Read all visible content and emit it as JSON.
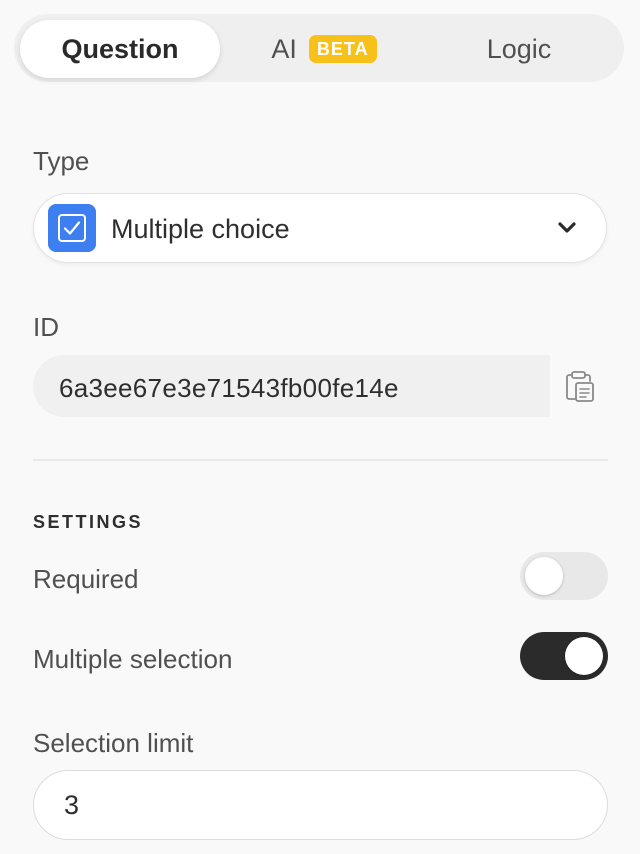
{
  "tabs": {
    "question": "Question",
    "ai": "AI",
    "ai_badge": "BETA",
    "logic": "Logic"
  },
  "type_section": {
    "label": "Type",
    "selected": "Multiple choice",
    "icon": "checkbox-icon",
    "chevron": "chevron-down-icon"
  },
  "id_section": {
    "label": "ID",
    "value": "6a3ee67e3e71543fb00fe14e",
    "copy_icon": "clipboard-icon"
  },
  "settings": {
    "title": "SETTINGS",
    "required_label": "Required",
    "required_on": false,
    "multiple_label": "Multiple selection",
    "multiple_on": true,
    "limit_label": "Selection limit",
    "limit_value": "3"
  },
  "colors": {
    "accent_blue": "#3d7ef0",
    "beta_badge": "#f8c11a",
    "toggle_on": "#2b2b2b",
    "toggle_off": "#e8e8e8"
  }
}
